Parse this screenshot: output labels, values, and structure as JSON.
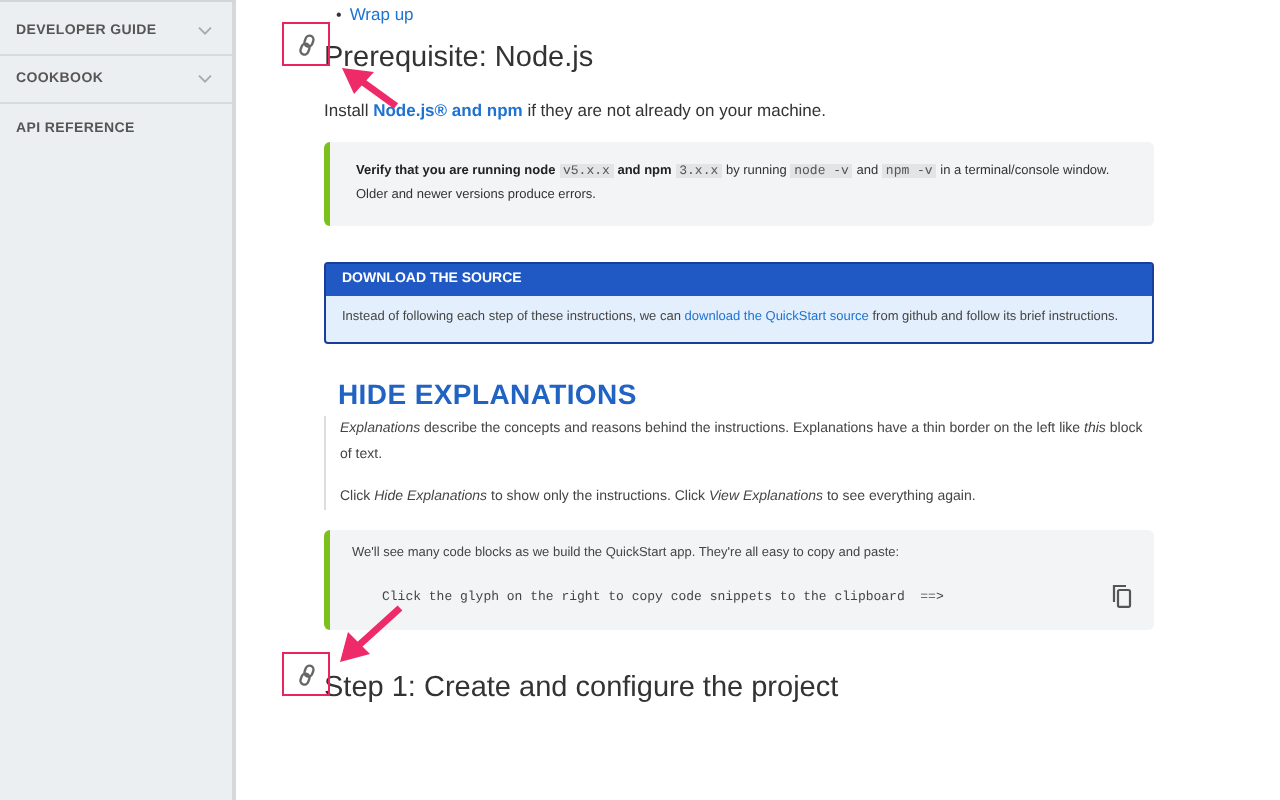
{
  "sidebar": {
    "items": [
      {
        "label": "DEVELOPER GUIDE",
        "expandable": true
      },
      {
        "label": "COOKBOOK",
        "expandable": true
      },
      {
        "label": "API REFERENCE",
        "expandable": false
      }
    ]
  },
  "toc_items": [
    {
      "marker": "•",
      "text": "Wrap up"
    }
  ],
  "prerequisite": {
    "heading": "Prerequisite: Node.js",
    "intro_before": "Install",
    "intro_link": "Node.js® and npm",
    "intro_after": "if they are not already on your machine."
  },
  "verify_callout": {
    "parts": [
      {
        "kind": "bold",
        "text": "Verify that you are running node"
      },
      {
        "kind": "code",
        "text": "v5.x.x"
      },
      {
        "kind": "bold",
        "text": "and npm"
      },
      {
        "kind": "code",
        "text": "3.x.x"
      },
      {
        "kind": "plain",
        "text": "by running"
      },
      {
        "kind": "code",
        "text": "node -v"
      },
      {
        "kind": "plain",
        "text": "and"
      },
      {
        "kind": "code",
        "text": "npm -v"
      },
      {
        "kind": "plain",
        "text": "in a terminal/console window."
      },
      {
        "kind": "plain",
        "text": "Older and newer versions produce errors."
      }
    ]
  },
  "download_box": {
    "title": "DOWNLOAD THE SOURCE",
    "text_before": "Instead of following each step of these instructions, we can",
    "link": "download the QuickStart source",
    "text_after": "from github and follow its brief instructions."
  },
  "explanations": {
    "heading": "HIDE EXPLANATIONS",
    "paragraphs": [
      "*Explanations* describe the concepts and reasons behind the instructions. Explanations have a thin border on the left like *this* block of text.",
      "Click *Hide Explanations* to show only the instructions. Click *View Explanations* to see everything again."
    ]
  },
  "code_block": {
    "intro": "We'll see many code blocks as we build the QuickStart app. They're all easy to copy and paste:",
    "code": "Click the glyph on the right to copy code snippets to the clipboard  ==>"
  },
  "step_heading": "Step 1: Create and configure the project"
}
